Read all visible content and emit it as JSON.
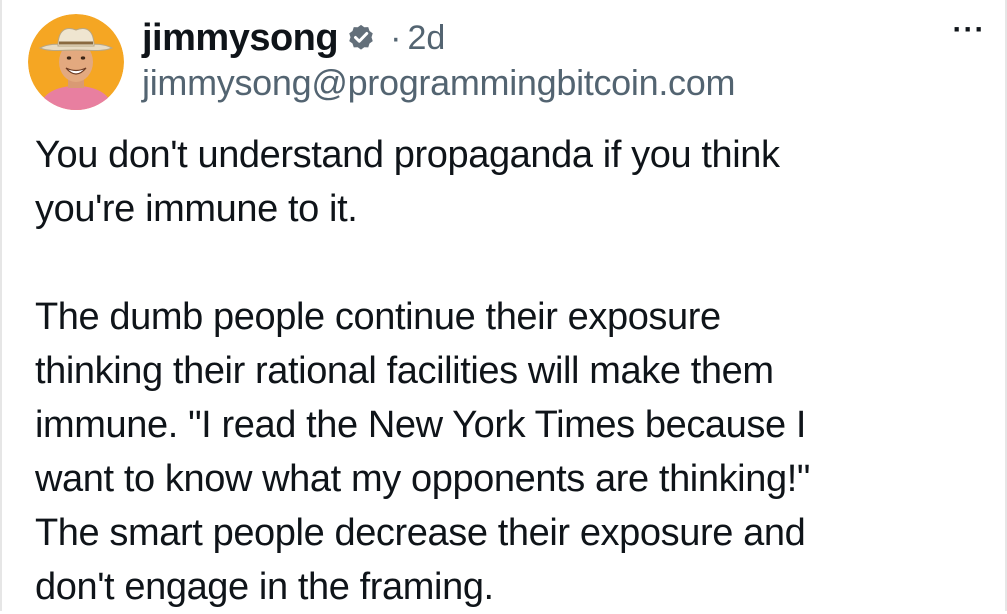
{
  "post": {
    "author": {
      "display_name": "jimmysong",
      "handle": "jimmysong@programmingbitcoin.com",
      "verified_icon": "verified-badge-icon",
      "avatar_icon": "avatar"
    },
    "separator": "·",
    "time": "2d",
    "more_menu": {
      "label": "···",
      "icon": "more-options-icon"
    },
    "paragraphs": [
      "You don't understand propaganda if you think\nyou're immune to it.",
      "The dumb people continue their exposure\nthinking their rational facilities will make them\nimmune. \"I read the New York Times because I\nwant to know what my opponents are thinking!\"\nThe smart people decrease their exposure and\ndon't engage in the framing."
    ]
  },
  "colors": {
    "text_primary": "#0f1419",
    "text_secondary": "#536471",
    "avatar_background": "#f5a623",
    "border": "#e6e6e6"
  }
}
